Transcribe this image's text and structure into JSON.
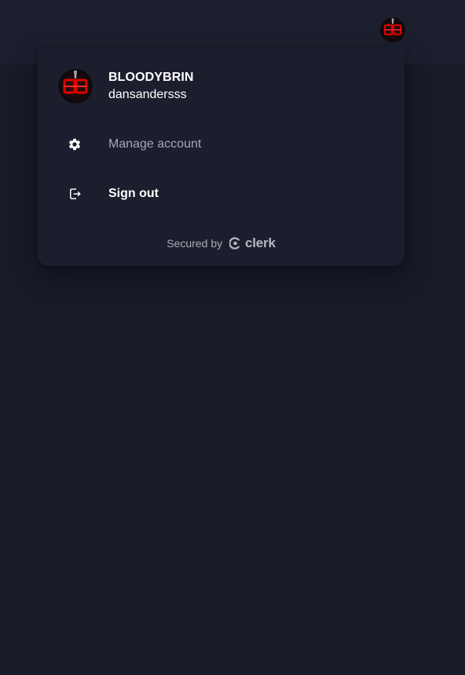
{
  "header": {
    "avatar_icon": "user-avatar-bb-logo"
  },
  "user_menu": {
    "display_name": "BLOODYBRIN",
    "username": "dansandersss",
    "avatar_icon": "user-avatar-bb-logo",
    "actions": [
      {
        "label": "Manage account",
        "icon": "gear-icon"
      },
      {
        "label": "Sign out",
        "icon": "sign-out-icon"
      }
    ],
    "footer": {
      "secured_by": "Secured by",
      "brand": "clerk",
      "brand_icon": "clerk-logo-icon"
    }
  },
  "colors": {
    "background": "#181b28",
    "topbar": "#1c1f2e",
    "popover": "#1c1e2d",
    "muted_text": "#a4a7b5",
    "avatar_red": "#d40000"
  }
}
